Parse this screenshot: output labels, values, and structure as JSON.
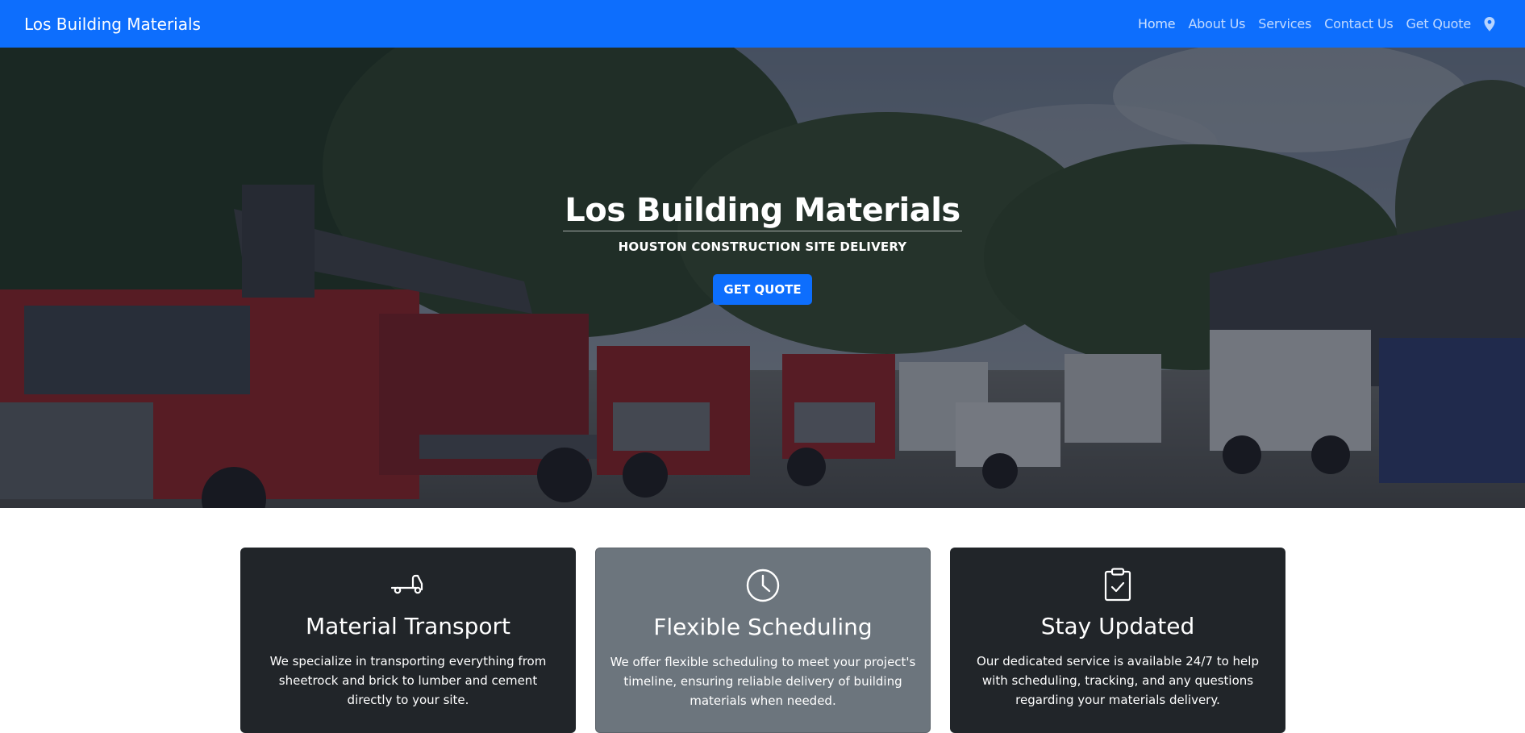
{
  "navbar": {
    "brand": "Los Building Materials",
    "links": [
      "Home",
      "About Us",
      "Services",
      "Contact Us",
      "Get Quote"
    ],
    "location_icon": "map-pin-icon",
    "background_color": "#0d6efd"
  },
  "hero": {
    "title": "Los Building Materials",
    "subtitle": "HOUSTON CONSTRUCTION SITE DELIVERY",
    "button_label": "GET QUOTE",
    "background_image": "fleet of red and white delivery trucks with cranes parked in a lot under trees"
  },
  "cards": [
    {
      "icon": "truck-icon",
      "title": "Material Transport",
      "text": "We specialize in transporting everything from sheetrock and brick to lumber and cement directly to your site.",
      "color": "#212529"
    },
    {
      "icon": "clock-icon",
      "title": "Flexible Scheduling",
      "text": "We offer flexible scheduling to meet your project's timeline, ensuring reliable delivery of building materials when needed.",
      "color": "#6c757d"
    },
    {
      "icon": "clipboard-check-icon",
      "title": "Stay Updated",
      "text": "Our dedicated service is available 24/7 to help with scheduling, tracking, and any questions regarding your materials delivery.",
      "color": "#212529"
    }
  ]
}
